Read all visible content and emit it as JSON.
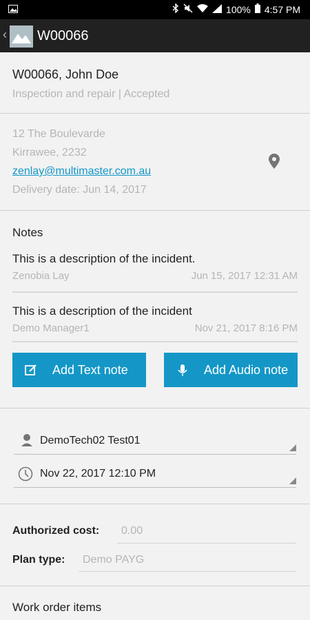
{
  "status": {
    "left_icon": "picture-icon",
    "battery": "100%",
    "time": "4:57 PM"
  },
  "appbar": {
    "title": "W00066"
  },
  "order": {
    "heading": "W00066, John Doe",
    "subheading": "Inspection and repair | Accepted"
  },
  "address": {
    "line1": "12 The Boulevarde",
    "line2": "Kirrawee, 2232",
    "email": "zenlay@multimaster.com.au",
    "delivery": "Delivery date: Jun 14, 2017"
  },
  "notes": {
    "title": "Notes",
    "items": [
      {
        "text": "This is a description of the incident.",
        "author": "Zenobia Lay",
        "date": "Jun 15, 2017 12:31 AM"
      },
      {
        "text": "This is a description of the incident",
        "author": "Demo Manager1",
        "date": "Nov 21, 2017 8:16 PM"
      }
    ],
    "add_text_label": "Add Text note",
    "add_audio_label": "Add Audio note"
  },
  "assignment": {
    "technician": "DemoTech02 Test01",
    "datetime": "Nov 22, 2017 12:10 PM"
  },
  "costs": {
    "authorized_label": "Authorized cost:",
    "authorized_value": "0.00",
    "plan_label": "Plan type:",
    "plan_value": "Demo PAYG"
  },
  "work_order_items": {
    "title": "Work order items"
  },
  "colors": {
    "accent": "#1497c7",
    "appbar": "#212121"
  }
}
